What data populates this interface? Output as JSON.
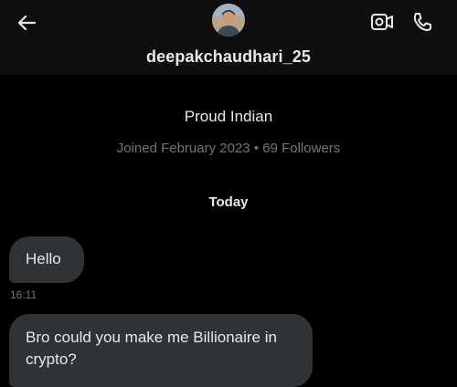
{
  "header": {
    "username": "deepakchaudhari_25",
    "icons": {
      "back": "back-arrow-icon",
      "video": "video-call-icon",
      "phone": "phone-call-icon"
    }
  },
  "profile": {
    "bio": "Proud Indian",
    "meta": "Joined February 2023 • 69 Followers"
  },
  "conversation": {
    "day_separator": "Today",
    "messages": [
      {
        "text": "Hello",
        "time": "16:11"
      },
      {
        "text": "Bro could you make me Billionaire in crypto?"
      }
    ]
  },
  "colors": {
    "background": "#000000",
    "header_background": "#0f0f10",
    "bubble": "#2f3336",
    "text_primary": "#e7e9ea",
    "text_secondary": "#71767b"
  }
}
